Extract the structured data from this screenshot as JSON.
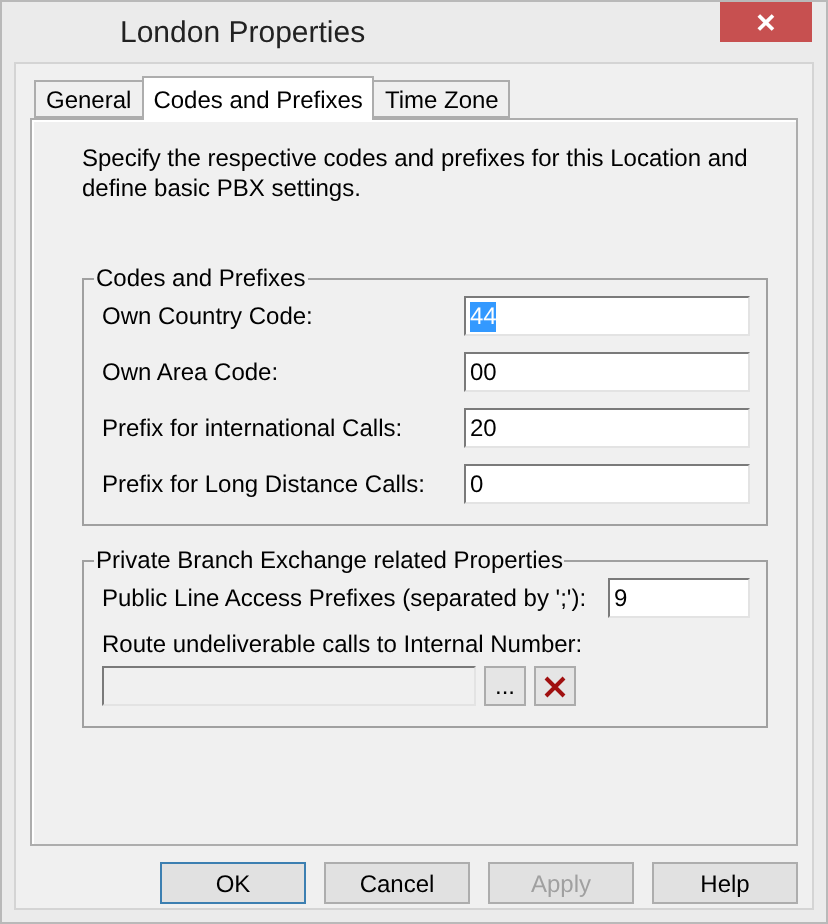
{
  "window": {
    "title": "London Properties",
    "close_icon": "✕"
  },
  "tabs": [
    {
      "label": "General",
      "selected": false
    },
    {
      "label": "Codes and Prefixes",
      "selected": true
    },
    {
      "label": "Time Zone",
      "selected": false
    }
  ],
  "intro": "Specify the respective codes and prefixes for this Location and define basic PBX settings.",
  "codes_group": {
    "title": "Codes and Prefixes",
    "fields": [
      {
        "label": "Own Country Code:",
        "value": "44",
        "focused": true
      },
      {
        "label": "Own Area Code:",
        "value": "00",
        "focused": false
      },
      {
        "label": "Prefix for international Calls:",
        "value": "20",
        "focused": false
      },
      {
        "label": "Prefix for Long Distance Calls:",
        "value": "0",
        "focused": false
      }
    ]
  },
  "pbx_group": {
    "title": "Private Branch Exchange related Properties",
    "prefixes": {
      "label": "Public Line Access Prefixes (separated by ';'):",
      "value": "9"
    },
    "route": {
      "label": "Route undeliverable calls to Internal Number:",
      "disabled": true,
      "browse": "..."
    }
  },
  "buttons": [
    {
      "label": "OK",
      "default": true,
      "disabled": false
    },
    {
      "label": "Cancel",
      "default": false,
      "disabled": false
    },
    {
      "label": "Apply",
      "default": false,
      "disabled": true
    },
    {
      "label": "Help",
      "default": false,
      "disabled": false
    }
  ]
}
